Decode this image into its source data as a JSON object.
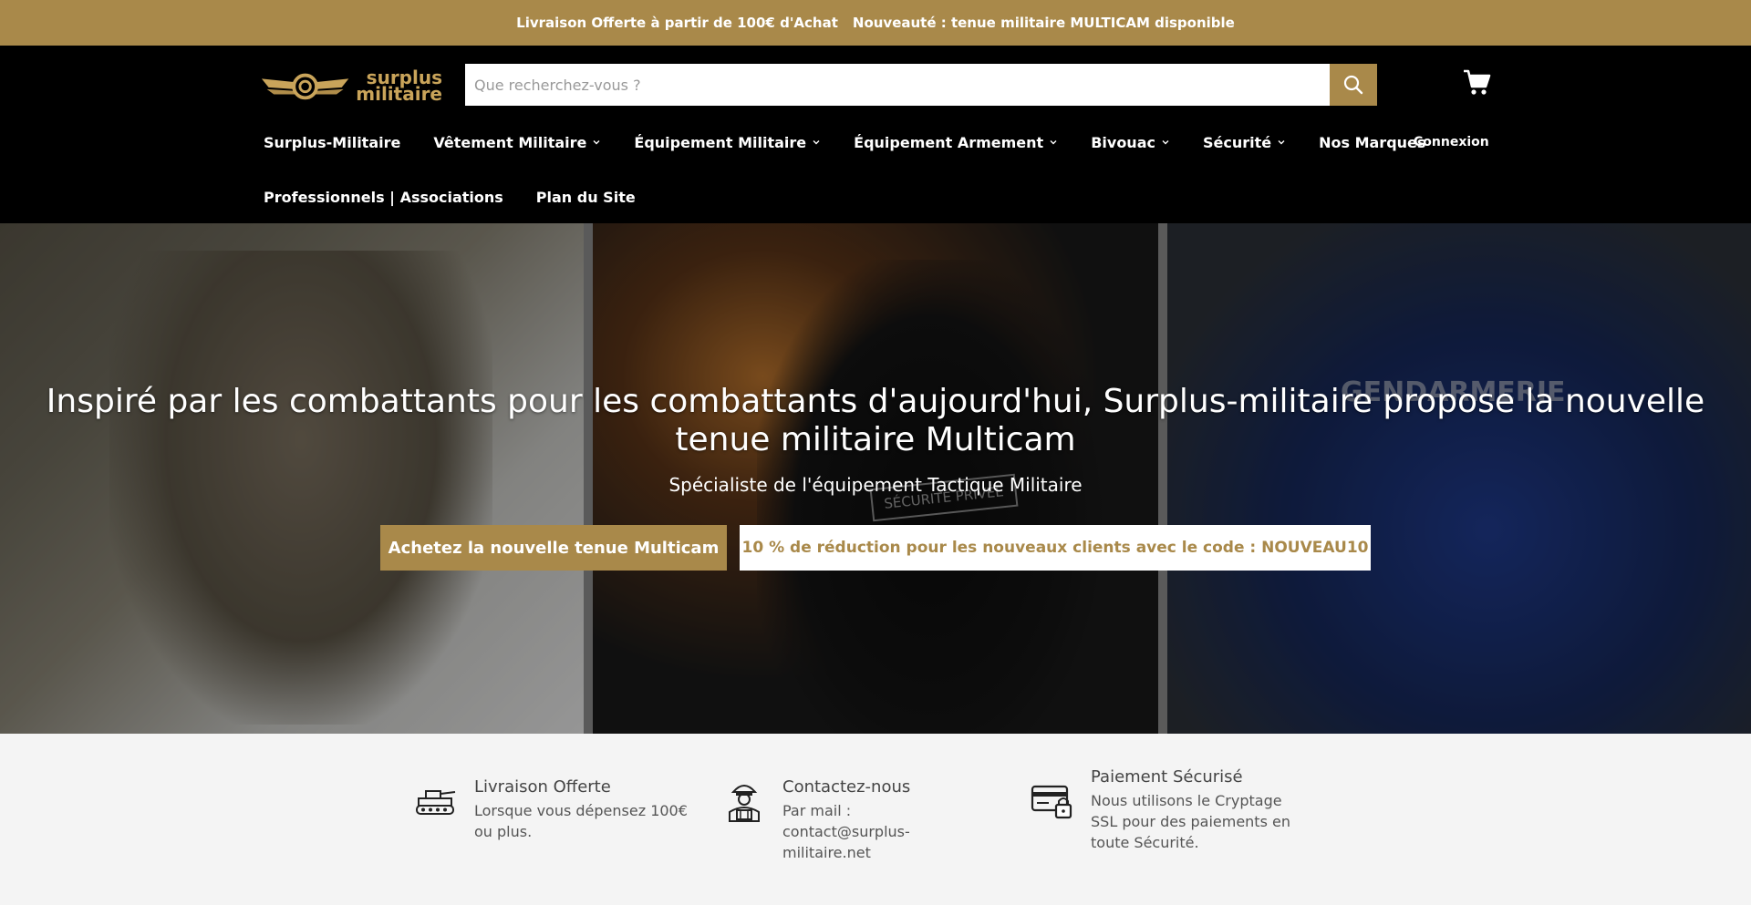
{
  "announcement": {
    "left": "Livraison Offerte à partir de 100€ d'Achat",
    "right": "Nouveauté : tenue militaire MULTICAM disponible"
  },
  "header": {
    "logo_line1": "surplus",
    "logo_line2": "militaire",
    "search_placeholder": "Que recherchez-vous ?",
    "login": "Connexion"
  },
  "nav": {
    "items": [
      {
        "label": "Surplus-Militaire",
        "dropdown": false
      },
      {
        "label": "Vêtement Militaire",
        "dropdown": true
      },
      {
        "label": "Équipement Militaire",
        "dropdown": true
      },
      {
        "label": "Équipement Armement",
        "dropdown": true
      },
      {
        "label": "Bivouac",
        "dropdown": true
      },
      {
        "label": "Sécurité",
        "dropdown": true
      },
      {
        "label": "Nos Marques",
        "dropdown": false
      }
    ],
    "row2": [
      {
        "label": "Professionnels | Associations"
      },
      {
        "label": "Plan du Site"
      }
    ]
  },
  "hero": {
    "title": "Inspiré par les combattants pour les combattants d'aujourd'hui, Surplus-militaire propose la nouvelle tenue militaire Multicam",
    "subtitle": "Spécialiste de l'équipement Tactique Militaire",
    "primary_button": "Achetez la nouvelle tenue Multicam",
    "secondary_button": "10 % de réduction pour les nouveaux clients avec le code : NOUVEAU10",
    "panel3_text": "GENDARMERIE",
    "panel2_text": "SÉCURITÉ PRIVÉE"
  },
  "features": [
    {
      "icon": "tank-icon",
      "title": "Livraison Offerte",
      "text": "Lorsque vous dépensez 100€ ou plus."
    },
    {
      "icon": "soldier-icon",
      "title": "Contactez-nous",
      "text": "Par mail : contact@surplus-militaire.net"
    },
    {
      "icon": "credit-card-lock-icon",
      "title": "Paiement Sécurisé",
      "text": "Nous utilisons le Cryptage SSL pour des paiements en toute Sécurité."
    }
  ],
  "colors": {
    "accent": "#a9894a",
    "header_bg": "#000000",
    "feature_bg": "#f4f4f4"
  }
}
